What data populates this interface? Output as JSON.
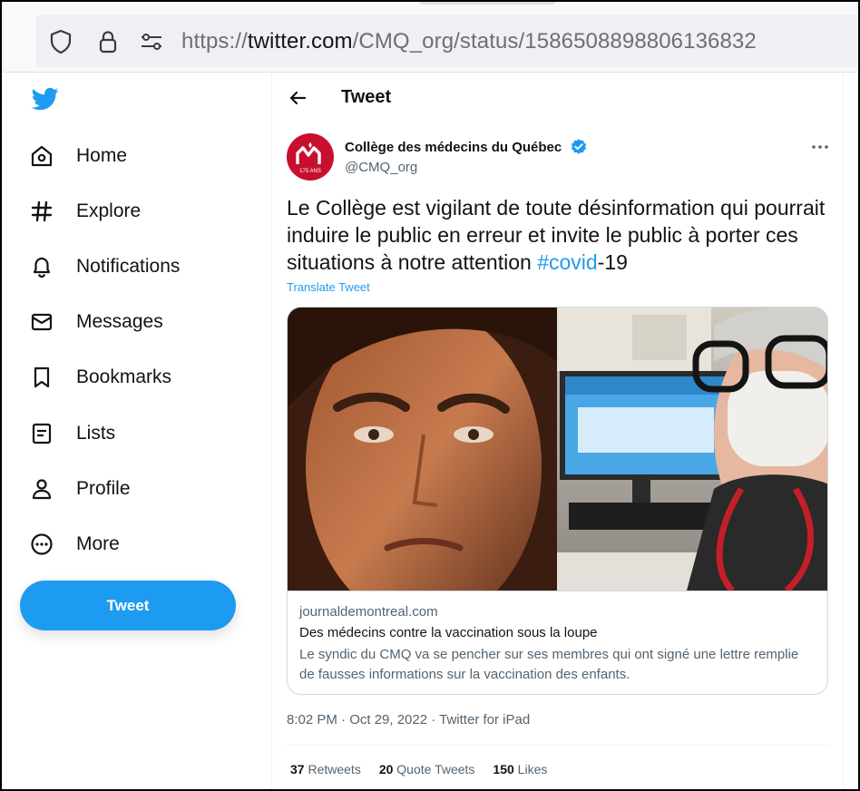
{
  "browser": {
    "url_prefix": "https://",
    "url_host": "twitter.com",
    "url_path": "/CMQ_org/status/1586508898806136832"
  },
  "sidebar": {
    "items": [
      {
        "label": "Home",
        "icon": "home-icon"
      },
      {
        "label": "Explore",
        "icon": "hashtag-icon"
      },
      {
        "label": "Notifications",
        "icon": "bell-icon"
      },
      {
        "label": "Messages",
        "icon": "envelope-icon"
      },
      {
        "label": "Bookmarks",
        "icon": "bookmark-icon"
      },
      {
        "label": "Lists",
        "icon": "list-icon"
      },
      {
        "label": "Profile",
        "icon": "person-icon"
      },
      {
        "label": "More",
        "icon": "more-circle-icon"
      }
    ],
    "tweet_button": "Tweet"
  },
  "header": {
    "title": "Tweet"
  },
  "tweet": {
    "author_name": "Collège des médecins du Québec",
    "author_handle": "@CMQ_org",
    "avatar_text": "175 ANS",
    "text_main": "Le Collège est vigilant de toute désinformation qui pourrait induire le public en erreur et invite le public à porter ces situations à notre attention ",
    "hashtag": "#covid",
    "text_tail": "-19",
    "translate": "Translate Tweet",
    "card": {
      "domain": "journaldemontreal.com",
      "title": "Des médecins contre la vaccination sous la loupe",
      "description": "Le syndic du CMQ va se pencher sur ses membres qui ont signé une lettre remplie de fausses informations sur la vaccination des enfants."
    },
    "timestamp": "8:02 PM · Oct 29, 2022 · Twitter for iPad",
    "stats": {
      "retweets_count": "37",
      "retweets_label": " Retweets",
      "quotes_count": "20",
      "quotes_label": " Quote Tweets",
      "likes_count": "150",
      "likes_label": " Likes"
    }
  },
  "colors": {
    "accent": "#1d9bf0",
    "brand_red": "#c8102e",
    "text": "#0f1419",
    "muted": "#536471"
  }
}
